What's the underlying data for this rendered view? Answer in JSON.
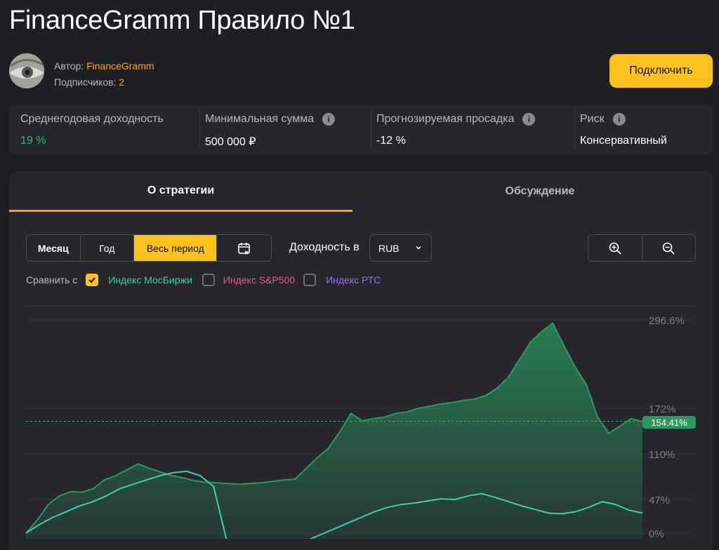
{
  "title": "FinanceGramm Правило №1",
  "author": {
    "label": "Автор:",
    "name": "FinanceGramm",
    "subscribers_label": "Подписчиков:",
    "subscribers": "2"
  },
  "connect_button": "Подключить",
  "stats": [
    {
      "label": "Среднегодовая доходность",
      "value": "19 %",
      "info": false
    },
    {
      "label": "Минимальная сумма",
      "value": "500 000 ₽",
      "info": true
    },
    {
      "label": "Прогнозируемая просадка",
      "value": "-12 %",
      "info": true
    },
    {
      "label": "Риск",
      "value": "Консервативный",
      "info": true
    }
  ],
  "tabs": {
    "about": "О стратегии",
    "discussion": "Обсуждение"
  },
  "periods": {
    "month": "Месяц",
    "year": "Год",
    "all": "Весь период"
  },
  "yield_label": "Доходность в",
  "currency": "RUB",
  "compare": {
    "label": "Сравнить с",
    "items": [
      {
        "label": "Индекс МосБиржи",
        "checked": true,
        "color": "#3dcfb2"
      },
      {
        "label": "Индекс S&P500",
        "checked": false,
        "color": "#e8568c"
      },
      {
        "label": "Индекс РТС",
        "checked": false,
        "color": "#9b6cf5"
      }
    ]
  },
  "chart_data": {
    "type": "area",
    "y_ticks": [
      "296.6%",
      "172%",
      "110%",
      "47%",
      "0%"
    ],
    "current_value_label": "154.41%",
    "series": [
      {
        "name": "FinanceGramm Правило №1",
        "color": "#2a9a5f",
        "values": [
          0,
          18,
          40,
          52,
          58,
          57,
          62,
          74,
          80,
          88,
          96,
          90,
          85,
          80,
          77,
          73,
          71,
          70,
          69,
          68,
          69,
          70,
          72,
          74,
          75,
          90,
          105,
          118,
          140,
          165,
          155,
          158,
          160,
          165,
          167,
          172,
          175,
          178,
          180,
          183,
          185,
          190,
          200,
          215,
          240,
          265,
          280,
          292,
          260,
          230,
          205,
          160,
          138,
          148,
          158,
          154
        ]
      },
      {
        "name": "Индекс МосБиржи",
        "color": "#3dcfb2",
        "values": [
          0,
          12,
          22,
          30,
          38,
          44,
          52,
          62,
          68,
          74,
          80,
          84,
          86,
          80,
          65,
          -12,
          -14,
          -16,
          -18,
          -19,
          -18,
          -10,
          -2,
          6,
          14,
          22,
          30,
          36,
          40,
          42,
          45,
          48,
          47,
          52,
          55,
          50,
          44,
          38,
          33,
          28,
          27,
          30,
          36,
          44,
          40,
          32,
          28
        ]
      }
    ]
  },
  "colors": {
    "accent": "#fcc21b",
    "link": "#f7a21b",
    "positive": "#2fb86b"
  }
}
